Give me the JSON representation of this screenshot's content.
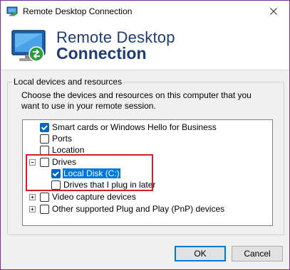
{
  "window": {
    "title": "Remote Desktop Connection",
    "icon": "rdc-icon",
    "close_glyph": "✕"
  },
  "banner": {
    "line1": "Remote Desktop",
    "line2": "Connection",
    "icon": "rdc-large-icon"
  },
  "group": {
    "label": "Local devices and resources",
    "description": "Choose the devices and resources on this computer that you want to use in your remote session."
  },
  "tree": {
    "items": [
      {
        "label": "Smart cards or Windows Hello for Business",
        "checked": true
      },
      {
        "label": "Ports",
        "checked": false
      },
      {
        "label": "Location",
        "checked": false
      },
      {
        "label": "Drives",
        "checked": false,
        "expanded": true,
        "expander": "⊟"
      },
      {
        "label": "Local Disk (C:)",
        "checked": true,
        "selected": true
      },
      {
        "label": "Drives that I plug in later",
        "checked": false
      },
      {
        "label": "Video capture devices",
        "checked": false,
        "expander": "⊞"
      },
      {
        "label": "Other supported Plug and Play (PnP) devices",
        "checked": false,
        "expander": "⊞"
      }
    ]
  },
  "buttons": {
    "ok": "OK",
    "cancel": "Cancel"
  },
  "colors": {
    "accent": "#0078d7",
    "banner_text": "#1f3d73",
    "highlight": "#d81f2a",
    "window_border": "#7a2e9a"
  }
}
